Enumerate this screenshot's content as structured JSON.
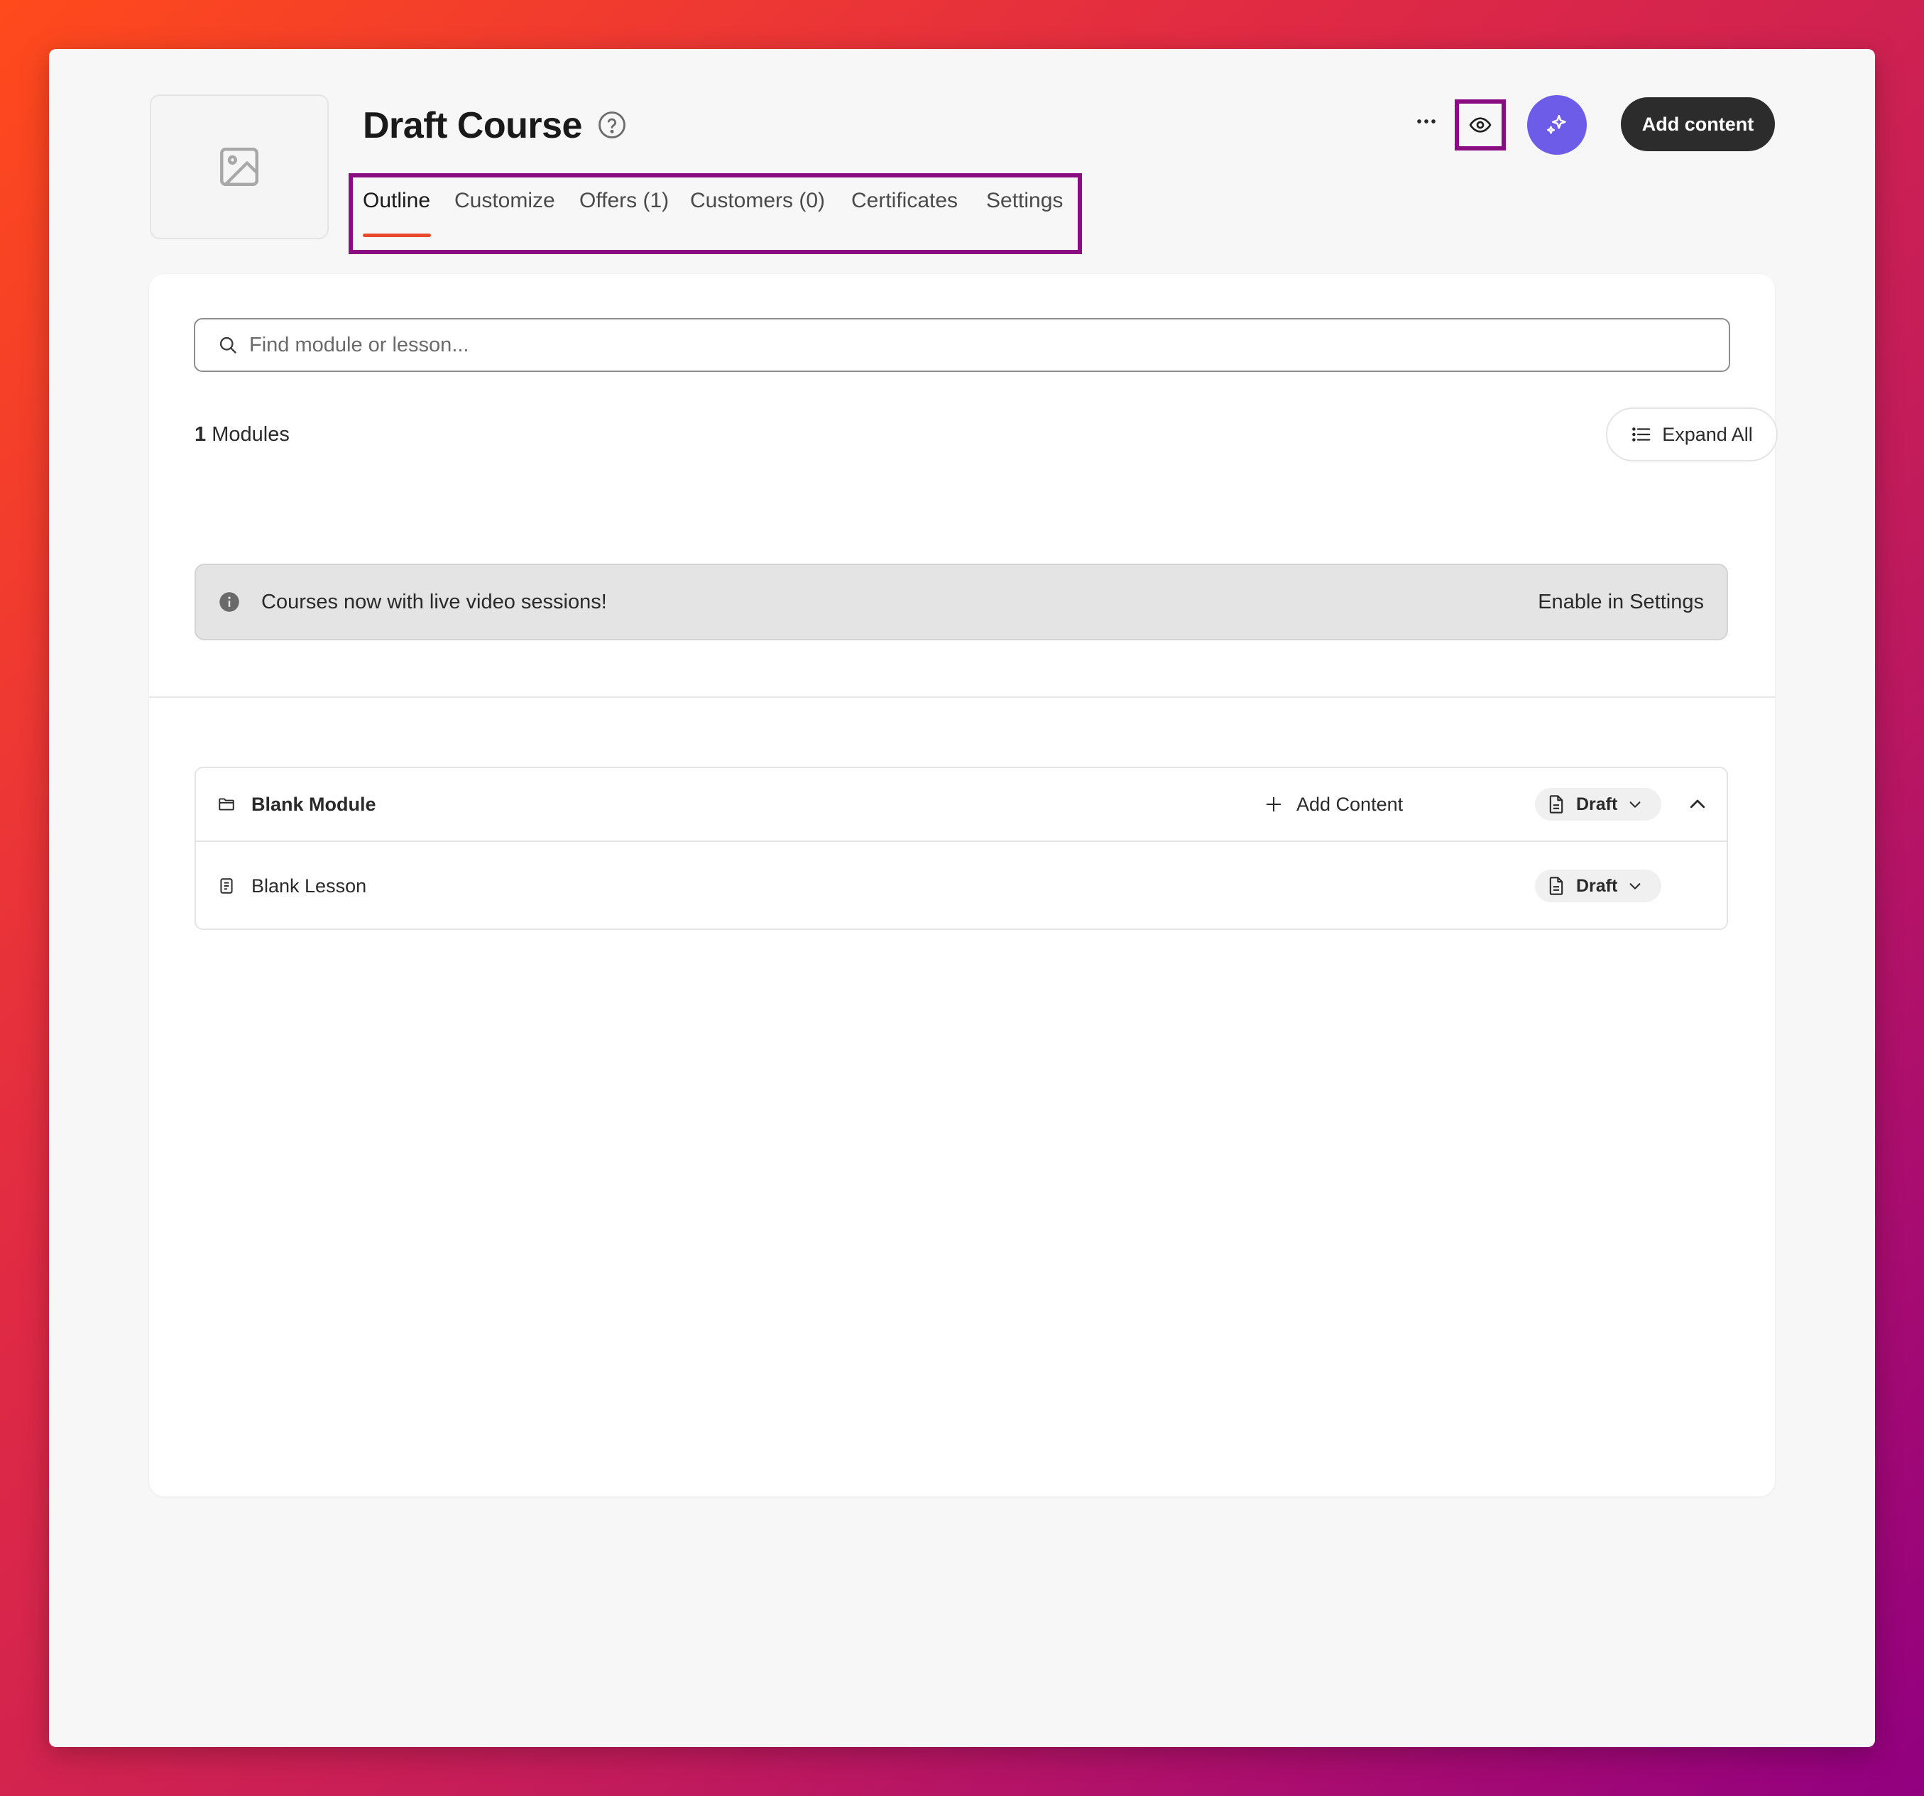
{
  "header": {
    "title": "Draft Course",
    "add_content_label": "Add content"
  },
  "tabs": [
    {
      "label": "Outline",
      "active": true
    },
    {
      "label": "Customize"
    },
    {
      "label": "Offers (1)"
    },
    {
      "label": "Customers (0)"
    },
    {
      "label": "Certificates"
    },
    {
      "label": "Settings"
    }
  ],
  "search": {
    "placeholder": "Find module or lesson..."
  },
  "outline": {
    "module_count": "1",
    "module_count_label": "Modules",
    "expand_all_label": "Expand All"
  },
  "banner": {
    "text": "Courses now with live video sessions!",
    "link": "Enable in Settings"
  },
  "modules": [
    {
      "name": "Blank Module",
      "add_content_label": "Add Content",
      "status": "Draft",
      "lessons": [
        {
          "name": "Blank Lesson",
          "status": "Draft"
        }
      ]
    }
  ],
  "colors": {
    "accent_underline": "#e94a2c",
    "ai_button": "#6c5ce7",
    "highlight_box": "#8a0d82",
    "primary_button": "#2c2c2c"
  },
  "icons": [
    "image-placeholder-icon",
    "help-icon",
    "more-icon",
    "eye-icon",
    "sparkle-icon",
    "search-icon",
    "list-icon",
    "info-icon",
    "folder-icon",
    "plus-icon",
    "document-icon",
    "chevron-down-icon",
    "chevron-up-icon",
    "lesson-icon"
  ]
}
